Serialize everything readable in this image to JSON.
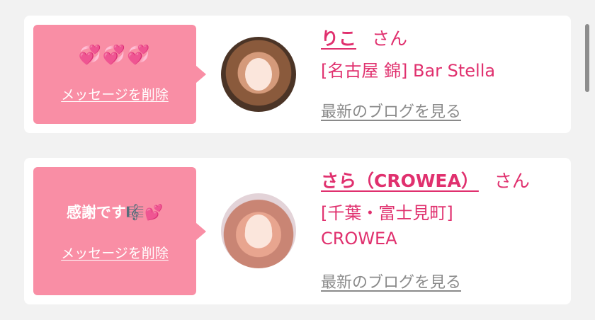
{
  "cards": [
    {
      "message": "💞💞💞",
      "delete_label": "メッセージを削除",
      "name": "りこ",
      "san": "さん",
      "shop": "[名古屋 錦] Bar Stella",
      "blog_label": "最新のブログを見る"
    },
    {
      "message": "感謝です🎼💕",
      "delete_label": "メッセージを削除",
      "name": "さら（CROWEA）",
      "san": "さん",
      "shop": "[千葉・富士見町] CROWEA",
      "blog_label": "最新のブログを見る"
    }
  ],
  "colors": {
    "bubble": "#f98ea5",
    "name": "#e0306e",
    "blog": "#8a8a8a",
    "background": "#f2f2f2"
  }
}
